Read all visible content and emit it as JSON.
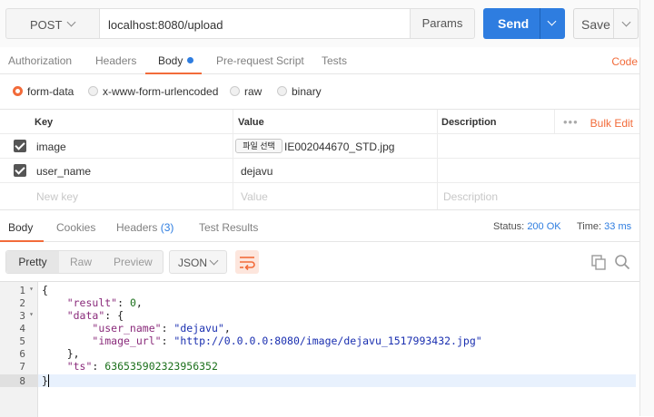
{
  "request": {
    "method": "POST",
    "url": "localhost:8080/upload",
    "params_label": "Params",
    "send_label": "Send",
    "save_label": "Save"
  },
  "request_tabs": [
    "Authorization",
    "Headers",
    "Body",
    "Pre-request Script",
    "Tests"
  ],
  "code_link": "Code",
  "body_types": [
    "form-data",
    "x-www-form-urlencoded",
    "raw",
    "binary"
  ],
  "kv_table": {
    "headers": [
      "Key",
      "Value",
      "Description"
    ],
    "bulk_edit": "Bulk Edit",
    "rows": [
      {
        "key": "image",
        "file_button": "파일 선택",
        "value": "IE002044670_STD.jpg"
      },
      {
        "key": "user_name",
        "value": "dejavu"
      }
    ],
    "new_key_placeholder": "New key",
    "value_placeholder": "Value",
    "description_placeholder": "Description"
  },
  "response_tabs": {
    "body": "Body",
    "cookies": "Cookies",
    "headers": "Headers",
    "headers_count": "(3)",
    "tests": "Test Results"
  },
  "status": {
    "status_label": "Status:",
    "status_value": "200 OK",
    "time_label": "Time:",
    "time_value": "33 ms"
  },
  "view_modes": [
    "Pretty",
    "Raw",
    "Preview"
  ],
  "format": "JSON",
  "code_lines": {
    "l1": "{",
    "l2_key": "\"result\"",
    "l2_val": "0",
    "l3_key": "\"data\"",
    "l3_rest": ": {",
    "l4_key": "\"user_name\"",
    "l4_val": "\"dejavu\"",
    "l5_key": "\"image_url\"",
    "l5_val": "\"http://0.0.0.0:8080/image/dejavu_1517993432.jpg\"",
    "l6": "},",
    "l7_key": "\"ts\"",
    "l7_val": "636535902323956352",
    "l8": "}"
  },
  "line_numbers": [
    "1",
    "2",
    "3",
    "4",
    "5",
    "6",
    "7",
    "8"
  ]
}
